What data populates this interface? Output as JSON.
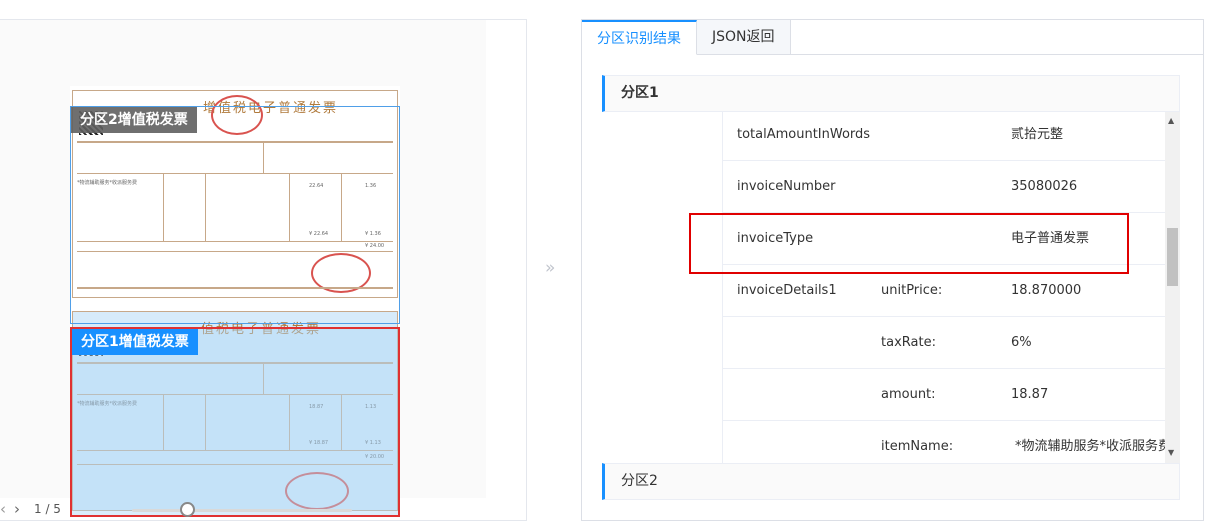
{
  "left": {
    "region_tags": [
      "分区2增值税发票",
      "分区1增值税发票"
    ],
    "invoice_title_top": "增值税电子普通发票",
    "invoice_title_bottom": "值税电子普通发票",
    "pager": {
      "prev_icon": "chevron-left-icon",
      "next_icon": "chevron-right-icon",
      "count": "1 / 5"
    }
  },
  "divider": {
    "icon": "double-chevron-right-icon",
    "glyph": "»"
  },
  "right": {
    "tabs": [
      "分区识别结果",
      "JSON返回"
    ],
    "active_tab": 0,
    "sections": [
      "分区1",
      "分区2"
    ],
    "rows": [
      {
        "key": "totalAmountInWords",
        "sub": "",
        "value": "贰拾元整"
      },
      {
        "key": "invoiceNumber",
        "sub": "",
        "value": "35080026"
      },
      {
        "key": "invoiceType",
        "sub": "",
        "value": "电子普通发票"
      },
      {
        "key": "invoiceDetails1",
        "sub": "unitPrice:",
        "value": "18.870000"
      },
      {
        "key": "",
        "sub": "taxRate:",
        "value": "6%"
      },
      {
        "key": "",
        "sub": "amount:",
        "value": "18.87"
      },
      {
        "key": "",
        "sub": "itemName:",
        "value": "*物流辅助服务*收派服务费"
      }
    ],
    "highlighted_row": "invoiceType",
    "colors": {
      "accent": "#1890ff",
      "highlight": "#e00000"
    }
  }
}
